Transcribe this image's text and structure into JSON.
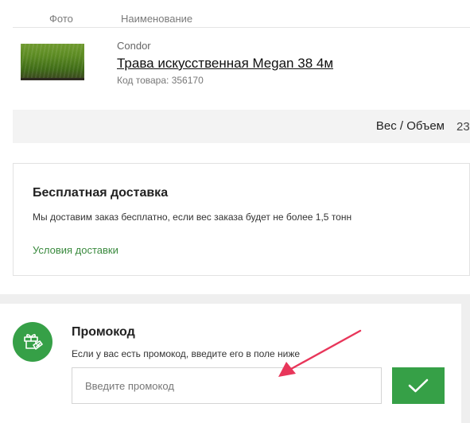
{
  "table_header": {
    "photo": "Фото",
    "name": "Наименование"
  },
  "product": {
    "brand": "Condor",
    "name": "Трава искусственная Megan 38 4м",
    "code": "Код товара: 356170"
  },
  "summary": {
    "weight_label": "Вес / Объем",
    "weight_value": "23"
  },
  "delivery": {
    "title": "Бесплатная доставка",
    "text": "Мы доставим заказ бесплатно, если вес заказа будет не более 1,5 тонн",
    "link": "Условия доставки"
  },
  "promo": {
    "title": "Промокод",
    "text": "Если у вас есть промокод, введите его в поле ниже",
    "placeholder": "Введите промокод",
    "value": ""
  },
  "colors": {
    "accent": "#36a047",
    "link": "#3a8a3e",
    "annotation": "#e8365a"
  },
  "icons": {
    "promo": "gift-percent-icon",
    "apply": "check-icon",
    "annotation": "arrow-annotation"
  }
}
